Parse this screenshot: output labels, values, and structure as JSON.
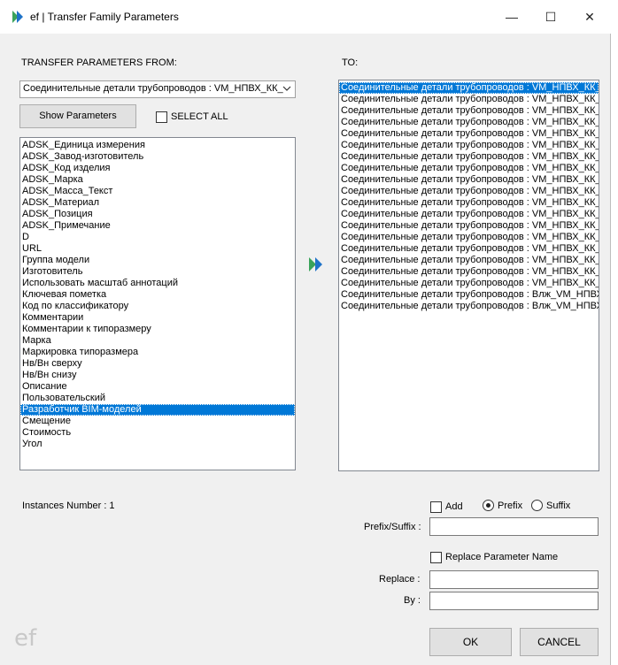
{
  "window": {
    "title": "ef | Transfer Family Parameters",
    "minimize_glyph": "—",
    "maximize_glyph": "☐",
    "close_glyph": "✕"
  },
  "left": {
    "header": "TRANSFER PARAMETERS FROM:",
    "source_selected": "Соединительные детали трубопроводов : VM_НПВХ_КК_",
    "show_parameters_label": "Show Parameters",
    "select_all_label": "SELECT ALL",
    "select_all_checked": false,
    "parameters": [
      "ADSK_Единица измерения",
      "ADSK_Завод-изготовитель",
      "ADSK_Код изделия",
      "ADSK_Марка",
      "ADSK_Масса_Текст",
      "ADSK_Материал",
      "ADSK_Позиция",
      "ADSK_Примечание",
      "D",
      "URL",
      "Группа модели",
      "Изготовитель",
      "Использовать масштаб аннотаций",
      "Ключевая пометка",
      "Код по классификатору",
      "Комментарии",
      "Комментарии к типоразмеру",
      "Марка",
      "Маркировка типоразмера",
      "Нв/Вн сверху",
      "Нв/Вн снизу",
      "Описание",
      "Пользовательский",
      "Разработчик BIM-моделей",
      "Смещение",
      "Стоимость",
      "Угол"
    ],
    "selected_parameter_index": 23,
    "instances_label": "Instances Number : 1"
  },
  "right": {
    "header": "TO:",
    "targets": [
      "Соединительные детали трубопроводов : VM_НПВХ_КК_",
      "Соединительные детали трубопроводов : VM_НПВХ_КК_",
      "Соединительные детали трубопроводов : VM_НПВХ_КК_",
      "Соединительные детали трубопроводов : VM_НПВХ_КК_",
      "Соединительные детали трубопроводов : VM_НПВХ_КК_",
      "Соединительные детали трубопроводов : VM_НПВХ_КК_",
      "Соединительные детали трубопроводов : VM_НПВХ_КК_",
      "Соединительные детали трубопроводов : VM_НПВХ_КК_",
      "Соединительные детали трубопроводов : VM_НПВХ_КК_",
      "Соединительные детали трубопроводов : VM_НПВХ_КК_",
      "Соединительные детали трубопроводов : VM_НПВХ_КК_",
      "Соединительные детали трубопроводов : VM_НПВХ_КК_",
      "Соединительные детали трубопроводов : VM_НПВХ_КК_",
      "Соединительные детали трубопроводов : VM_НПВХ_КК_",
      "Соединительные детали трубопроводов : VM_НПВХ_КК_",
      "Соединительные детали трубопроводов : VM_НПВХ_КК_",
      "Соединительные детали трубопроводов : VM_НПВХ_КК_",
      "Соединительные детали трубопроводов : VM_НПВХ_КК_",
      "Соединительные детали трубопроводов : Влж_VM_НПВХ",
      "Соединительные детали трубопроводов : Влж_VM_НПВХ"
    ],
    "selected_target_index": 0
  },
  "options": {
    "add_label": "Add",
    "add_checked": false,
    "prefix_label": "Prefix",
    "prefix_selected": true,
    "suffix_label": "Suffix",
    "suffix_selected": false,
    "prefix_suffix_label": "Prefix/Suffix :",
    "prefix_suffix_value": "",
    "replace_name_label": "Replace Parameter Name",
    "replace_name_checked": false,
    "replace_label": "Replace :",
    "replace_value": "",
    "by_label": "By :",
    "by_value": ""
  },
  "buttons": {
    "ok_label": "OK",
    "cancel_label": "CANCEL"
  },
  "logo_text": "ef",
  "colors": {
    "selection": "#0078d7",
    "accent_green": "#3aa35a",
    "accent_blue": "#1e73c8"
  }
}
